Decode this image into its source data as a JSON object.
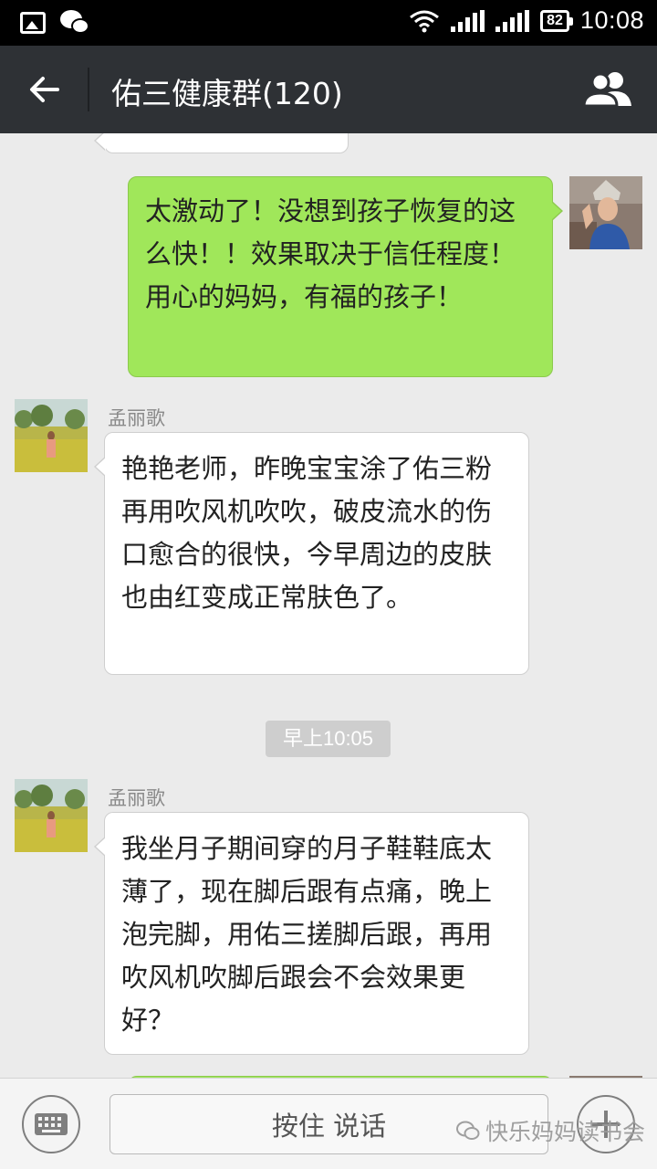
{
  "status_bar": {
    "battery_level": "82",
    "time": "10:08",
    "icons": [
      "gallery-icon",
      "wechat-icon",
      "wifi-icon",
      "signal-icon",
      "signal-icon",
      "battery-icon"
    ]
  },
  "header": {
    "title": "佑三健康群(120)",
    "back_icon": "back-arrow-icon",
    "members_icon": "group-members-icon"
  },
  "messages": [
    {
      "type": "outgoing",
      "text": "太激动了！没想到孩子恢复的这么快！！效果取决于信任程度！用心的妈妈，有福的孩子！"
    },
    {
      "type": "incoming",
      "sender": "孟丽歌",
      "text": "艳艳老师，昨晚宝宝涂了佑三粉再用吹风机吹吹，破皮流水的伤口愈合的很快，今早周边的皮肤也由红变成正常肤色了。"
    },
    {
      "type": "timestamp",
      "text": "早上10:05"
    },
    {
      "type": "incoming",
      "sender": "孟丽歌",
      "text": "我坐月子期间穿的月子鞋鞋底太薄了，现在脚后跟有点痛，晚上泡完脚，用佑三搓脚后跟，再用吹风机吹脚后跟会不会效果更好？"
    }
  ],
  "input_bar": {
    "keyboard_icon": "keyboard-icon",
    "voice_label": "按住 说话",
    "plus_icon": "plus-icon"
  },
  "watermark": {
    "text": "快乐妈妈读书会"
  },
  "colors": {
    "title_bar": "#2e3135",
    "chat_background": "#ebebeb",
    "outgoing_bubble": "#a0e75a",
    "incoming_bubble": "#ffffff"
  }
}
